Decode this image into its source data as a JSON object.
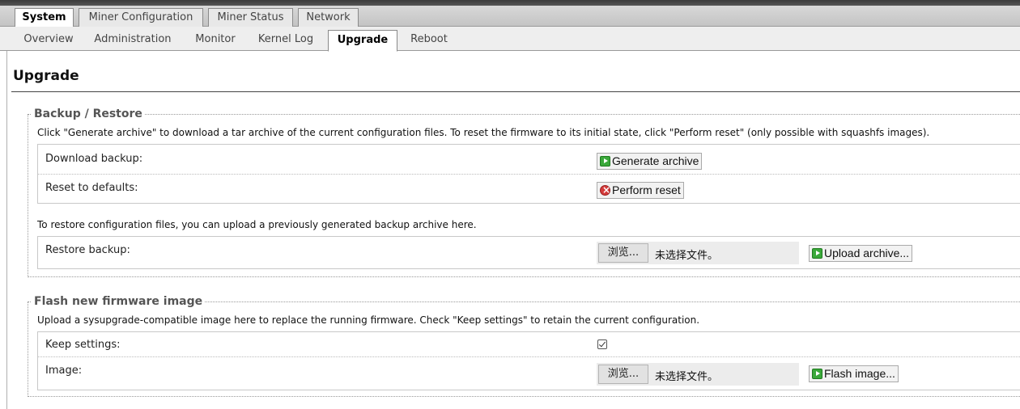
{
  "main_tabs": [
    {
      "label": "System",
      "active": true
    },
    {
      "label": "Miner Configuration",
      "active": false
    },
    {
      "label": "Miner Status",
      "active": false
    },
    {
      "label": "Network",
      "active": false
    }
  ],
  "sub_tabs": [
    {
      "label": "Overview",
      "active": false
    },
    {
      "label": "Administration",
      "active": false
    },
    {
      "label": "Monitor",
      "active": false
    },
    {
      "label": "Kernel Log",
      "active": false
    },
    {
      "label": "Upgrade",
      "active": true
    },
    {
      "label": "Reboot",
      "active": false
    }
  ],
  "page_title": "Upgrade",
  "backup_section": {
    "legend": "Backup / Restore",
    "description": "Click \"Generate archive\" to download a tar archive of the current configuration files. To reset the firmware to its initial state, click \"Perform reset\" (only possible with squashfs images).",
    "download_label": "Download backup:",
    "generate_button": "Generate archive",
    "reset_label": "Reset to defaults:",
    "reset_button": "Perform reset",
    "restore_description": "To restore configuration files, you can upload a previously generated backup archive here.",
    "restore_label": "Restore backup:",
    "browse_button": "浏览...",
    "no_file_text": "未选择文件。",
    "upload_button": "Upload archive..."
  },
  "flash_section": {
    "legend": "Flash new firmware image",
    "description": "Upload a sysupgrade-compatible image here to replace the running firmware. Check \"Keep settings\" to retain the current configuration.",
    "keep_settings_label": "Keep settings:",
    "keep_settings_checked": true,
    "image_label": "Image:",
    "browse_button": "浏览...",
    "no_file_text": "未选择文件。",
    "flash_button": "Flash image..."
  },
  "colors": {
    "button_icon_green": "#3aa83a",
    "button_icon_red": "#d43b3b"
  }
}
